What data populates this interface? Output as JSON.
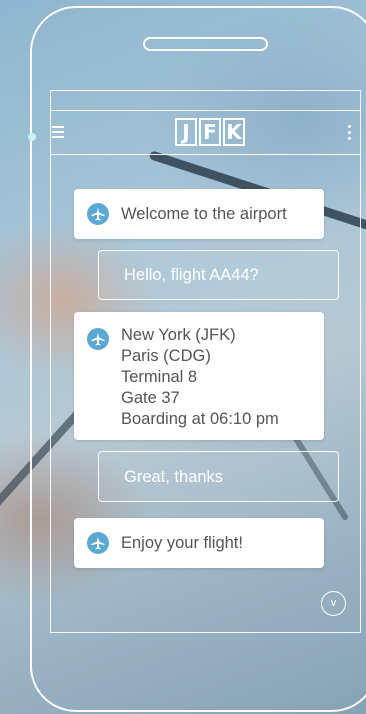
{
  "header": {
    "logo_letters": [
      "J",
      "F",
      "K"
    ]
  },
  "messages": [
    {
      "from": "airport",
      "icon": "plane-icon",
      "lines": [
        "Welcome to the airport"
      ]
    },
    {
      "from": "user",
      "lines": [
        "Hello, flight AA44?"
      ]
    },
    {
      "from": "airport",
      "icon": "plane-icon",
      "lines": [
        "New York (JFK)",
        "Paris (CDG)",
        "Terminal 8",
        "Gate 37",
        "Boarding at 06:10 pm"
      ]
    },
    {
      "from": "user",
      "lines": [
        "Great, thanks"
      ]
    },
    {
      "from": "airport",
      "icon": "plane-icon",
      "lines": [
        "Enjoy your flight!"
      ]
    }
  ],
  "scroll_button": {
    "label": "v",
    "icon": "chevron-down-icon"
  },
  "colors": {
    "accent": "#5aa9d3",
    "bubble_text": "#555555",
    "frame": "#ffffff"
  }
}
